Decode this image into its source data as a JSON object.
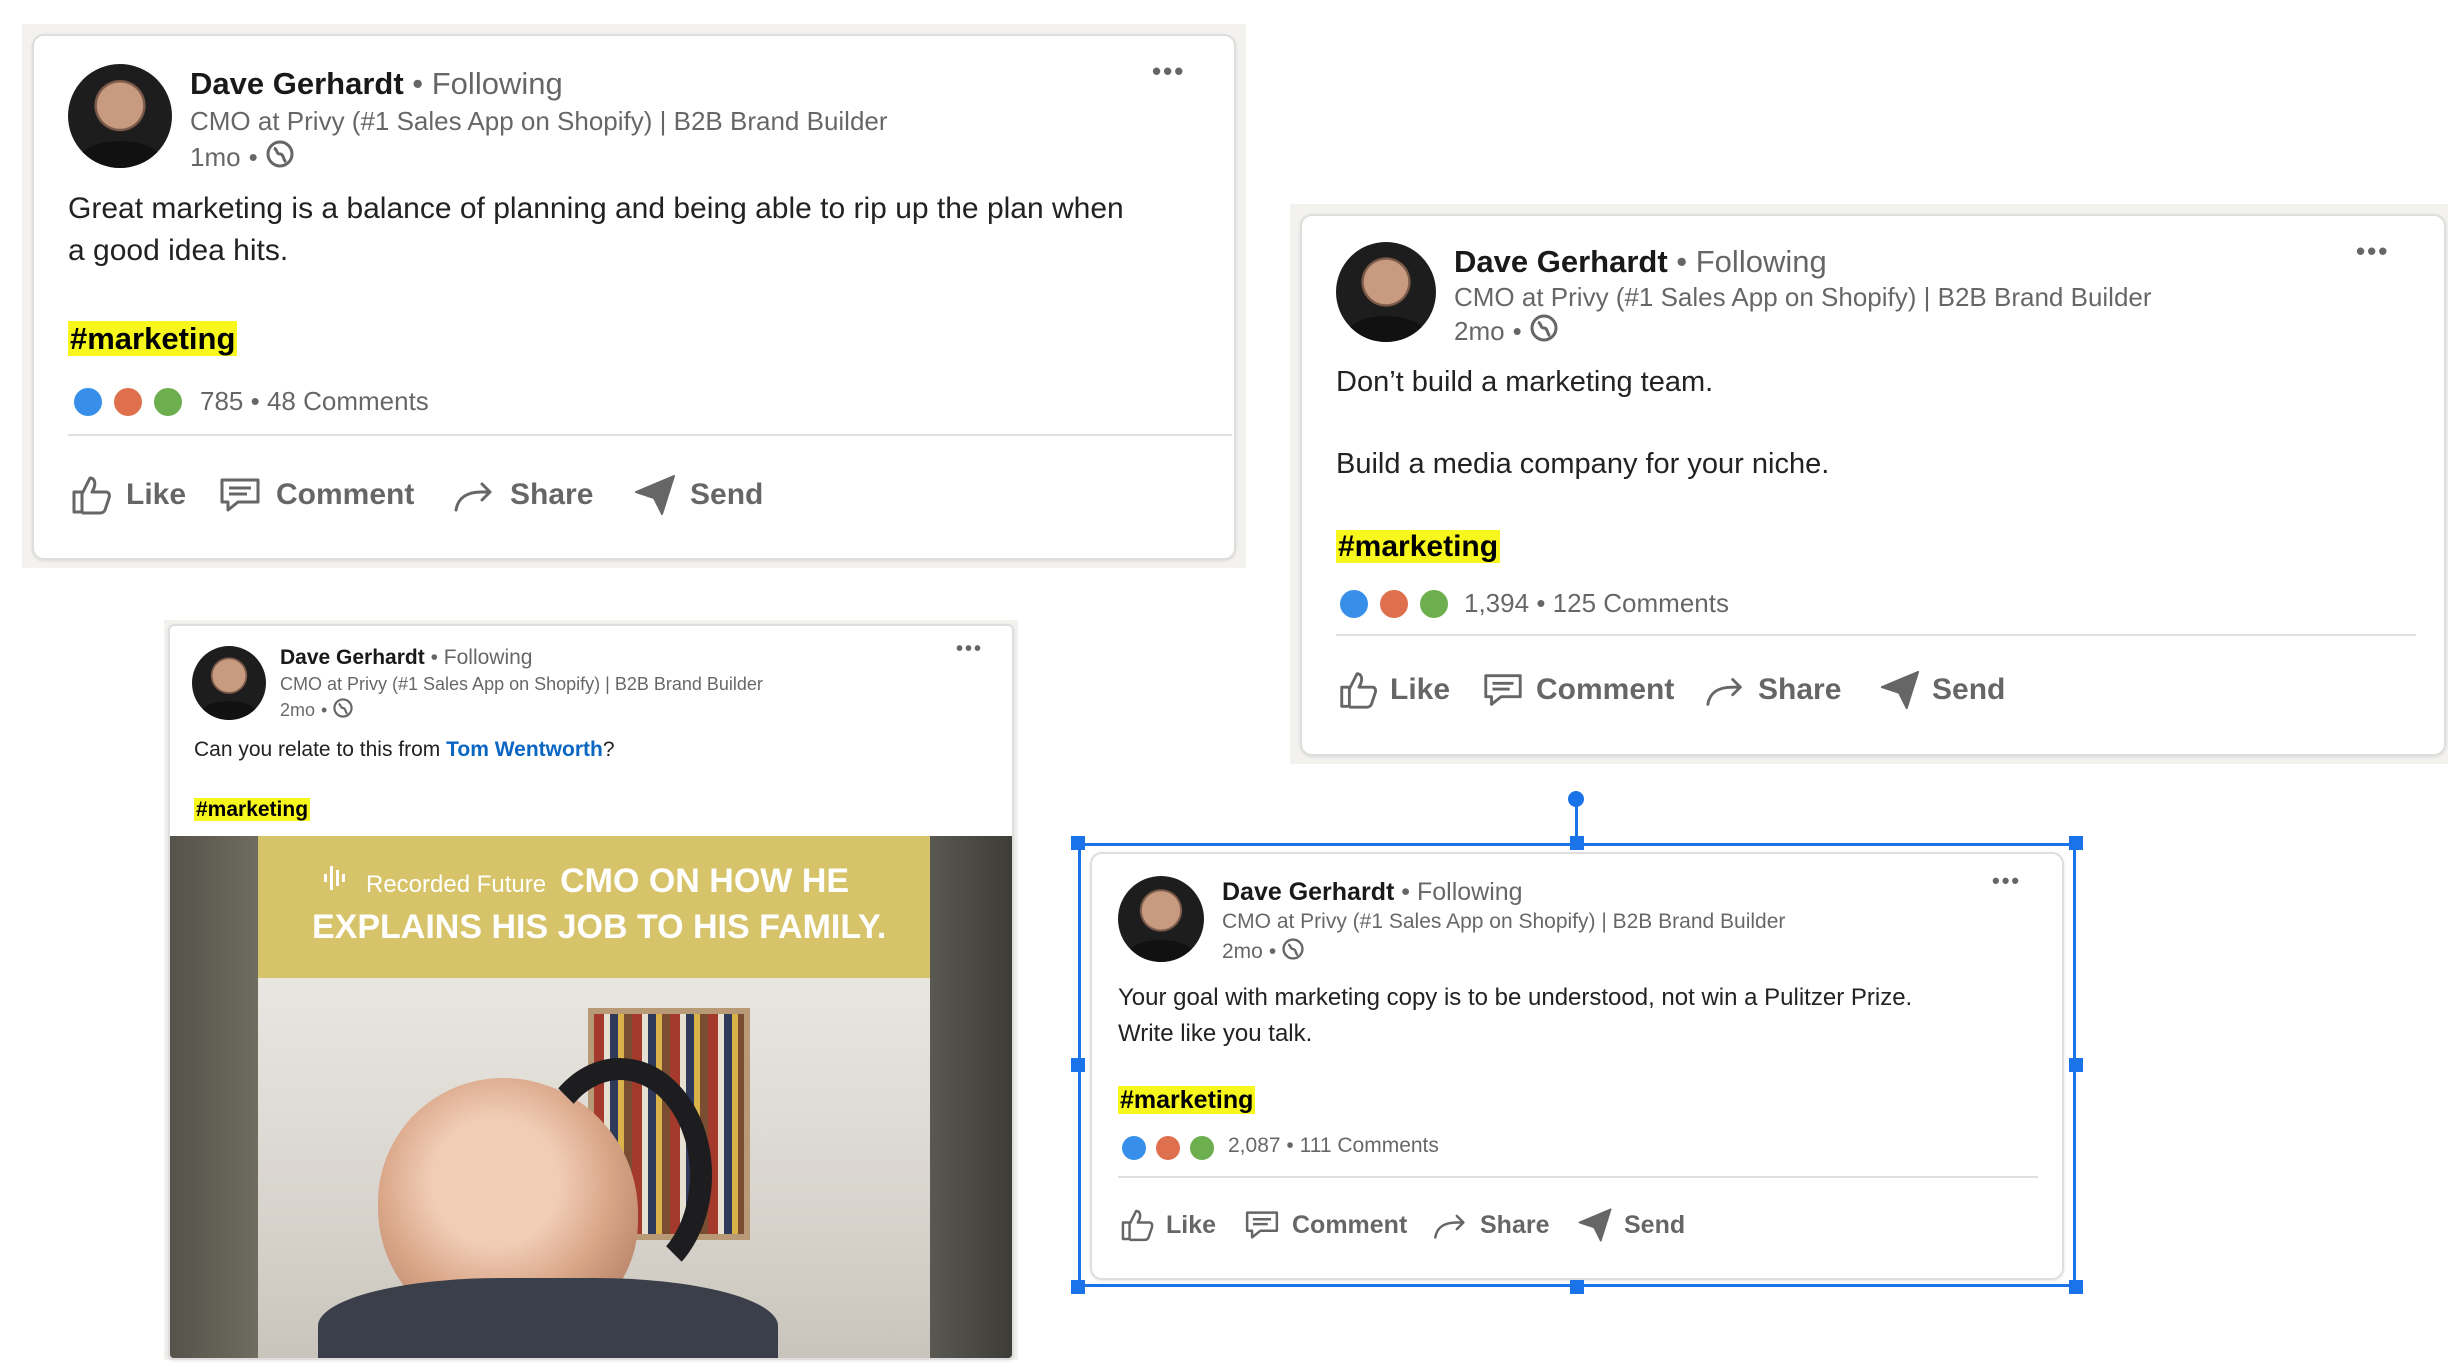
{
  "colors": {
    "accent": "#0a66c2",
    "hashtag_highlight": "#f7f71e",
    "selection": "#1a73e8",
    "like": "#378fe9",
    "love": "#df704d",
    "insightful": "#6dae4f"
  },
  "posts": [
    {
      "author": "Dave Gerhardt",
      "following": "Following",
      "headline": "CMO at Privy (#1 Sales App on Shopify) | B2B Brand Builder",
      "time": "1mo",
      "visibility_icon": "globe-icon",
      "body_lines": [
        "Great marketing is a balance of planning and being able to rip up the plan when",
        "a good idea hits."
      ],
      "hashtag": "#marketing",
      "reaction_count": "785",
      "comments": "48 Comments",
      "actions": [
        "Like",
        "Comment",
        "Share",
        "Send"
      ],
      "menu": "•••"
    },
    {
      "author": "Dave Gerhardt",
      "following": "Following",
      "headline": "CMO at Privy (#1 Sales App on Shopify) | B2B Brand Builder",
      "time": "2mo",
      "visibility_icon": "globe-icon",
      "body_lines": [
        "Don’t build a marketing team.",
        "Build a media company for your niche."
      ],
      "hashtag": "#marketing",
      "reaction_count": "1,394",
      "comments": "125 Comments",
      "actions": [
        "Like",
        "Comment",
        "Share",
        "Send"
      ],
      "menu": "•••"
    },
    {
      "author": "Dave Gerhardt",
      "following": "Following",
      "headline": "CMO at Privy (#1 Sales App on Shopify) | B2B Brand Builder",
      "time": "2mo",
      "visibility_icon": "globe-icon",
      "body_prefix": "Can you relate to this from ",
      "body_link": "Tom Wentworth",
      "body_suffix": "?",
      "hashtag": "#marketing",
      "video": {
        "brand": "Recorded Future",
        "headline_line1": "CMO ON HOW HE",
        "headline_line2": "EXPLAINS HIS JOB TO HIS FAMILY."
      },
      "menu": "•••"
    },
    {
      "author": "Dave Gerhardt",
      "following": "Following",
      "headline": "CMO at Privy (#1 Sales App on Shopify) | B2B Brand Builder",
      "time": "2mo",
      "visibility_icon": "globe-icon",
      "body_lines": [
        "Your goal with marketing copy is to be understood, not win a Pulitzer Prize.",
        "Write like you talk."
      ],
      "hashtag": "#marketing",
      "reaction_count": "2,087",
      "comments": "111 Comments",
      "actions": [
        "Like",
        "Comment",
        "Share",
        "Send"
      ],
      "menu": "•••"
    }
  ],
  "dot": "•"
}
